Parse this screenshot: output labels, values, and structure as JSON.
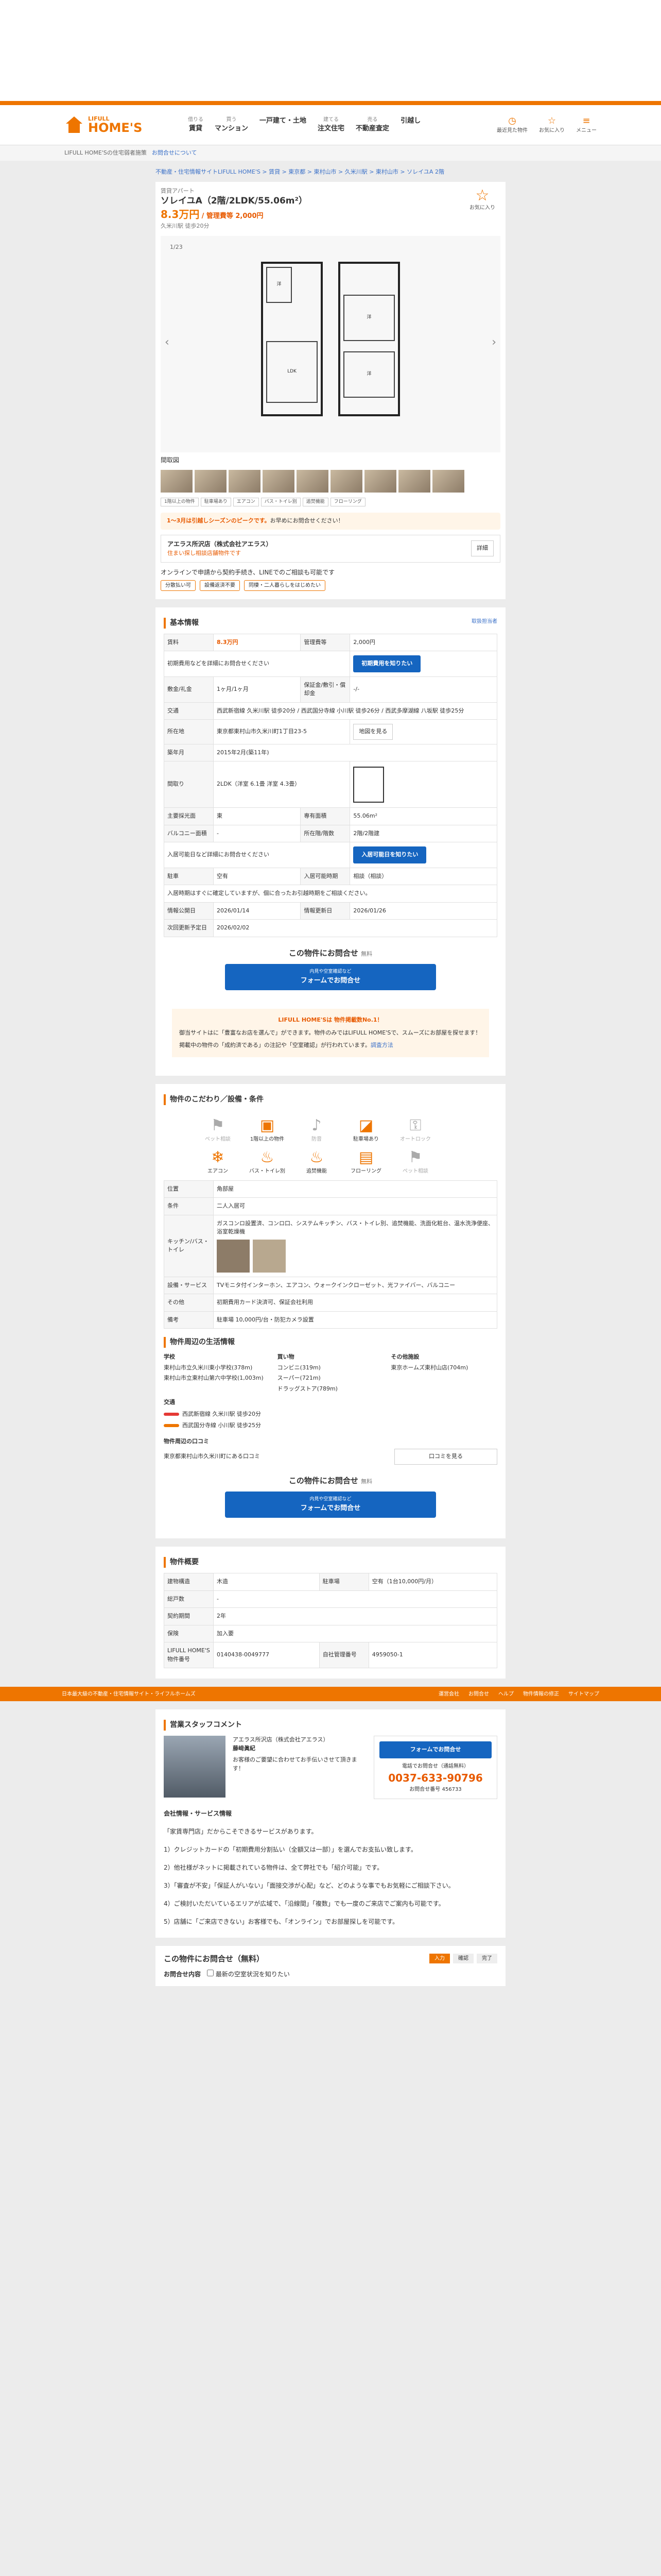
{
  "header": {
    "brand_small": "LIFULL",
    "brand": "HOME'S",
    "nav": [
      {
        "s": "借りる",
        "b": "賃貸"
      },
      {
        "s": "買う",
        "b": "マンション"
      },
      {
        "s": "",
        "b": "一戸建て・土地"
      },
      {
        "s": "建てる",
        "b": "注文住宅"
      },
      {
        "s": "売る",
        "b": "不動産査定"
      },
      {
        "s": "",
        "b": "引越し"
      }
    ],
    "right": [
      "最近見た物件",
      "お気に入り",
      "メニュー"
    ]
  },
  "subbar": {
    "text": "LIFULL HOME'Sの住宅弱者施策",
    "link": "お問合せについて"
  },
  "breadcrumb": "不動産・住宅情報サイトLIFULL HOME'S > 賃貸 > 東京都 > 東村山市 > 久米川駅 > 東村山市 > ソレイユA 2階",
  "property": {
    "type": "賃貸アパート",
    "title": "ソレイユA（2階/2LDK/55.06m²）",
    "price": "8.3万円",
    "price_sub": "/ 管理費等 2,000円",
    "sub_line": "久米川駅 徒歩20分",
    "fav": "お気に入り"
  },
  "gallery": {
    "count": "1/23",
    "caption": "間取図",
    "tags": [
      "1階以上の物件",
      "駐車場あり",
      "エアコン",
      "バス・トイレ別",
      "追焚機能",
      "フローリング"
    ]
  },
  "notice": {
    "bold": "1～3月は引越しシーズンのピークです。",
    "text": "お早めにお問合せください！"
  },
  "agent": {
    "name": "アエラス所沢店（株式会社アエラス）",
    "sub": "住まい探し相談店舗物件です",
    "detail": "詳細"
  },
  "online": {
    "text": "オンラインで申請から契約手続き、LINEでのご相談も可能です",
    "features": [
      "分散払い可",
      "設備返済不要",
      "同棲・二人暮らしをはじめたい"
    ]
  },
  "basic": {
    "title": "基本情報",
    "link": "取扱担当者",
    "rows": [
      {
        "k": "賃料",
        "v": "8.3万円",
        "k2": "管理費等",
        "v2": "2,000円"
      },
      {
        "k": "初期費用",
        "v": "初期費用などを詳細にお問合せください",
        "btn": "初期費用を知りたい"
      },
      {
        "k": "敷金/礼金",
        "v": "1ヶ月/1ヶ月",
        "k2": "保証金/敷引・償却金",
        "v2": "-/-"
      },
      {
        "k": "交通",
        "v": "西武新宿線 久米川駅 徒歩20分 / 西武国分寺線 小川駅 徒歩26分 / 西武多摩湖線 八坂駅 徒歩25分"
      },
      {
        "k": "所在地",
        "v": "東京都東村山市久米川町1丁目23-5",
        "btn": "地図を見る"
      },
      {
        "k": "築年月",
        "v": "2015年2月(築11年)"
      },
      {
        "k": "間取り",
        "v": "2LDK（洋室 6.1畳 洋室 4.3畳）"
      },
      {
        "k": "主要採光面",
        "v": "東",
        "k2": "専有面積",
        "v2": "55.06m²"
      },
      {
        "k": "バルコニー面積",
        "v": "-",
        "k2": "所在階/階数",
        "v2": "2階/2階建"
      },
      {
        "k": "入居可能日",
        "v": "入居可能日など詳細にお問合せください",
        "btn": "入居可能日を知りたい"
      },
      {
        "k": "駐車",
        "v": "空有",
        "k2": "入居可能時期",
        "v2": "相談（相談）"
      },
      {
        "k": "情報公開日",
        "v": "2026/01/14",
        "k2": "情報更新日",
        "v2": "2026/01/26"
      },
      {
        "k": "次回更新予定日",
        "v": "2026/02/02"
      }
    ],
    "note": "入居時期はすぐに確定していますが、個に合ったお引越時期をご相談ください。"
  },
  "contact": {
    "head": "この物件にお問合せ",
    "free": "無料",
    "btn_small": "内見や空室確認など",
    "btn": "フォームでお問合せ"
  },
  "pr": {
    "title": "LIFULL HOME'Sは 物件掲載数No.1！",
    "p1": "御当サイトはに「豊富なお店を選んで」ができます。物件のみではLIFULL HOME'Sで、スムーズにお部屋を探せます！",
    "p2": "掲載中の物件の「成約済である」の注記や「空室確認」が行われています。",
    "link": "調査方法"
  },
  "kodawari": {
    "title": "物件のこだわり／設備・条件",
    "icons": [
      {
        "n": "ペット相談",
        "on": false
      },
      {
        "n": "1階以上の物件",
        "on": true
      },
      {
        "n": "防音",
        "on": false
      },
      {
        "n": "駐車場あり",
        "on": true
      },
      {
        "n": "オートロック",
        "on": false
      },
      {
        "n": "エアコン",
        "on": true
      },
      {
        "n": "バス・トイレ別",
        "on": true
      },
      {
        "n": "追焚機能",
        "on": true
      },
      {
        "n": "フローリング",
        "on": true
      },
      {
        "n": "ペット相談",
        "on": false
      }
    ],
    "rows": [
      {
        "k": "位置",
        "v": "角部屋"
      },
      {
        "k": "条件",
        "v": "二人入居可"
      },
      {
        "k": "キッチン/バス・トイレ",
        "v": "ガスコンロ設置済、コンロ口、システムキッチン、バス・トイレ別、追焚機能、洗面化粧台、温水洗浄便座、浴室乾燥機"
      },
      {
        "k": "設備・サービス",
        "v": "TVモニタ付インターホン、エアコン、ウォークインクローゼット、光ファイバー、バルコニー"
      },
      {
        "k": "その他",
        "v": "初期費用カード決済可、保証会社利用"
      },
      {
        "k": "備考",
        "v": "駐車場 10,000円/台・防犯カメラ設置"
      }
    ]
  },
  "life": {
    "title": "物件周辺の生活情報",
    "school": "学校",
    "schools": [
      "東村山市立久米川東小学校(378m)",
      "東村山市立東村山第六中学校(1,003m)"
    ],
    "shop": "買い物",
    "shops": [
      "コンビニ(319m)",
      "スーパー(721m)",
      "ドラッグストア(789m)"
    ],
    "other": "その他施設",
    "others": [
      "東京ホームズ東村山店(704m)"
    ],
    "traffic": "交通",
    "lines": [
      "西武新宿線 久米川駅 徒歩20分",
      "西武国分寺線 小川駅 徒歩25分"
    ],
    "kuchi_title": "物件周辺の口コミ",
    "kuchi": "東京都東村山市久米川町にある口コミ",
    "kuchi_btn": "口コミを見る"
  },
  "gaiyou": {
    "title": "物件概要",
    "rows": [
      {
        "k": "建物構造",
        "v": "木造",
        "k2": "駐車場",
        "v2": "空有（1台10,000円/月）"
      },
      {
        "k": "総戸数",
        "v": "-"
      },
      {
        "k": "契約期間",
        "v": "2年"
      },
      {
        "k": "保険",
        "v": "加入要"
      },
      {
        "k": "LIFULL HOME'S物件番号",
        "v": "0140438-0049777",
        "k2": "自社管理番号",
        "v2": "4959050-1"
      }
    ]
  },
  "footbar": {
    "left": "日本最大級の不動産・住宅情報サイト・ライフルホームズ",
    "right": [
      "運営会社",
      "お問合せ",
      "ヘルプ",
      "物件情報の修正",
      "サイトマップ"
    ]
  },
  "staff": {
    "title": "営業スタッフコメント",
    "company": "アエラス所沢店（株式会社アエラス）",
    "name": "藤﨑眞紀",
    "msg": "お客様のご要望に合わせてお手伝いさせて頂きます！",
    "box_btn": "フォームでお問合せ",
    "tel_label": "電話でお問合せ（通話無料）",
    "tel": "0037-633-90796",
    "id": "お問合せ番号 456733",
    "long": [
      "会社情報・サービス情報",
      "「家賃専門店」だからこそできるサービスがあります。",
      "1）クレジットカードの「初期費用分割払い（全額又は一部）」を選んでお支払い致します。",
      "2）他社様がネットに掲載されている物件は、全て弊社でも「紹介可能」です。",
      "3）「審査が不安」「保証人がいない」「面接交渉が心配」など、どのような事でもお気軽にご相談下さい。",
      "4）ご検討いただいているエリアが広域で、「沿線間」「複数」でも一度のご来店でご案内も可能です。",
      "5）店舗に「ご来店できない」お客様でも、「オンライン」でお部屋探しを可能です。"
    ]
  },
  "final": {
    "head": "この物件にお問合せ（無料）",
    "steps": [
      "入力",
      "確認",
      "完了"
    ],
    "label": "お問合せ内容",
    "option": "最新の空室状況を知りたい"
  }
}
